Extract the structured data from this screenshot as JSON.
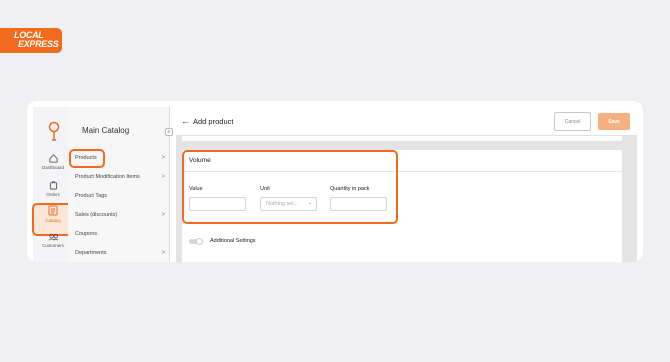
{
  "brand": {
    "logo_line1": "LOCAL",
    "logo_line2": "EXPRESS",
    "accent": "#f26a1b"
  },
  "rail": {
    "items": [
      {
        "label": "Dashboard",
        "icon": "home-icon"
      },
      {
        "label": "Orders",
        "icon": "bag-icon"
      },
      {
        "label": "Catalog",
        "icon": "catalog-icon",
        "active": true
      },
      {
        "label": "Customers",
        "icon": "customers-icon"
      }
    ]
  },
  "catalog": {
    "title": "Main Catalog",
    "collapse_icon": "collapse-icon",
    "items": [
      {
        "label": "Products",
        "chevron": ">"
      },
      {
        "label": "Product Modification Items",
        "chevron": ">"
      },
      {
        "label": "Product Tags",
        "chevron": ""
      },
      {
        "label": "Sales (discounts)",
        "chevron": ">"
      },
      {
        "label": "Coupons",
        "chevron": ""
      },
      {
        "label": "Departments",
        "chevron": ">"
      }
    ]
  },
  "header": {
    "back_icon": "←",
    "title": "Add product",
    "cancel_label": "Cancel",
    "save_label": "Save"
  },
  "volume": {
    "title": "Volume",
    "value_label": "Value",
    "value": "",
    "unit_label": "Unit",
    "unit_placeholder": "Nothing sel...",
    "unit_chevron": "⌄",
    "qty_label": "Quantity in pack",
    "qty_value": ""
  },
  "additional": {
    "label": "Additional Settings",
    "enabled": false
  }
}
